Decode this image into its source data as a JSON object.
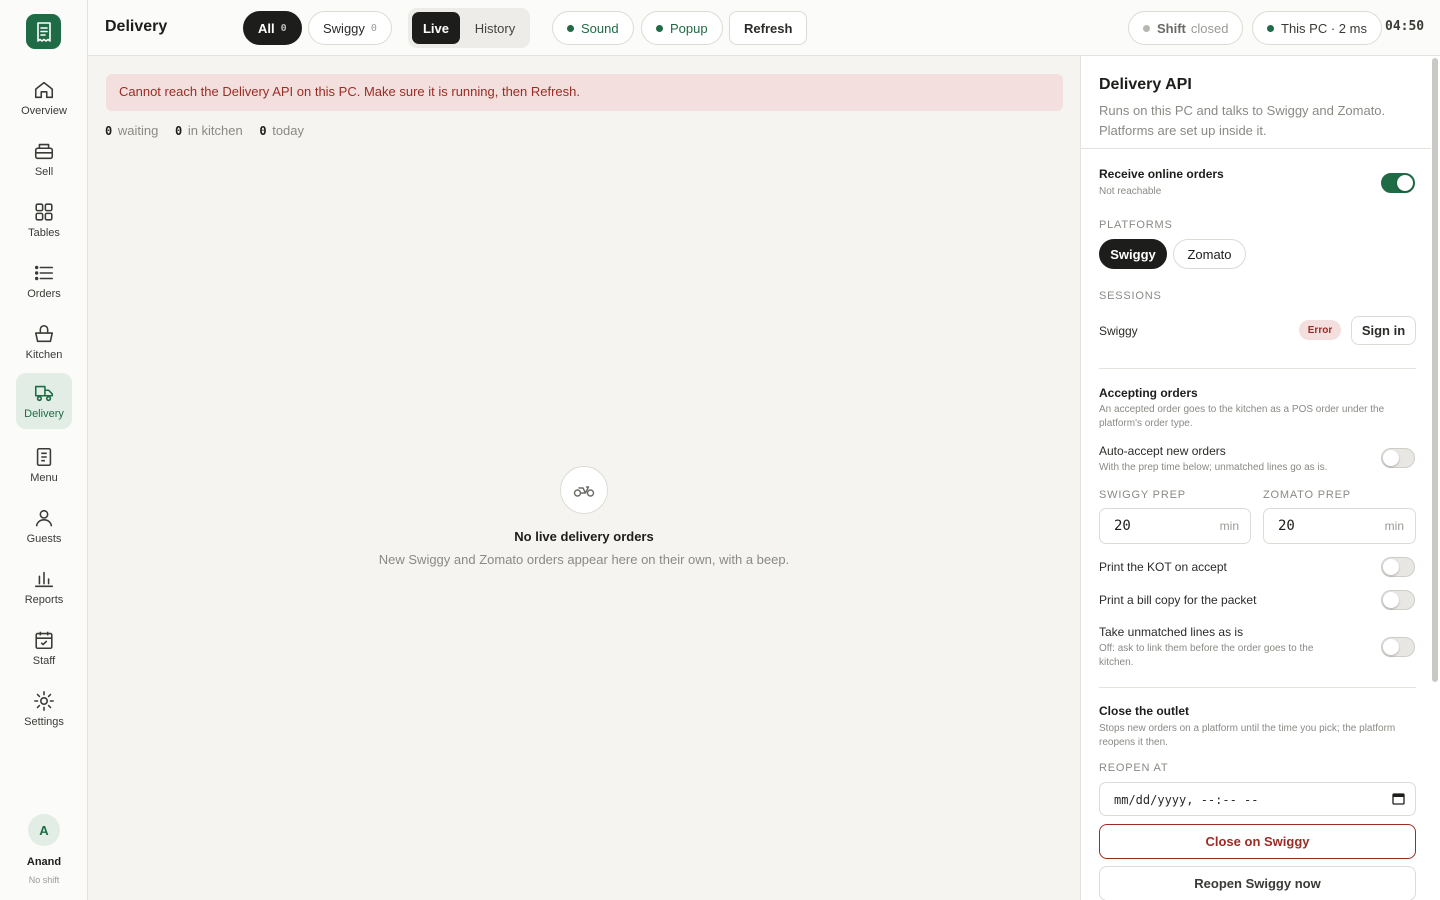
{
  "sidebar": {
    "logo": "receipt-icon",
    "items": [
      {
        "label": "Overview",
        "icon": "home-icon"
      },
      {
        "label": "Sell",
        "icon": "register-icon"
      },
      {
        "label": "Tables",
        "icon": "grid-icon"
      },
      {
        "label": "Orders",
        "icon": "list-icon"
      },
      {
        "label": "Kitchen",
        "icon": "basket-icon"
      },
      {
        "label": "Delivery",
        "icon": "delivery-truck-icon",
        "active": true
      },
      {
        "label": "Menu",
        "icon": "menu-doc-icon"
      },
      {
        "label": "Guests",
        "icon": "person-icon"
      },
      {
        "label": "Reports",
        "icon": "bar-chart-icon"
      },
      {
        "label": "Staff",
        "icon": "calendar-check-icon"
      },
      {
        "label": "Settings",
        "icon": "gear-icon"
      }
    ],
    "user": {
      "initial": "A",
      "name": "Anand",
      "shift": "No shift"
    }
  },
  "topbar": {
    "title": "Delivery",
    "filters": [
      {
        "label": "All",
        "count": "0",
        "active": true
      },
      {
        "label": "Swiggy",
        "count": "0",
        "active": false
      }
    ],
    "view_toggle": {
      "live": "Live",
      "history": "History",
      "selected": "Live"
    },
    "sound": "Sound",
    "popup": "Popup",
    "refresh": "Refresh",
    "shift_label": "Shift",
    "shift_status": "closed",
    "connection": "This PC · 2 ms",
    "clock": "04:50"
  },
  "main": {
    "error_banner": "Cannot reach the Delivery API on this PC. Make sure it is running, then Refresh.",
    "stats": [
      {
        "value": "0",
        "label": "waiting"
      },
      {
        "value": "0",
        "label": "in kitchen"
      },
      {
        "value": "0",
        "label": "today"
      }
    ],
    "empty": {
      "icon": "scooter-icon",
      "title": "No live delivery orders",
      "subtitle": "New Swiggy and Zomato orders appear here on their own, with a beep."
    }
  },
  "panel": {
    "title": "Delivery API",
    "description": "Runs on this PC and talks to Swiggy and Zomato. Platforms are set up inside it.",
    "receive": {
      "label": "Receive online orders",
      "status": "Not reachable",
      "enabled": true
    },
    "platforms_caption": "PLATFORMS",
    "platforms": [
      "Swiggy",
      "Zomato"
    ],
    "selected_platform": "Swiggy",
    "sessions_caption": "SESSIONS",
    "session": {
      "platform": "Swiggy",
      "badge": "Error",
      "action": "Sign in"
    },
    "accepting": {
      "title": "Accepting orders",
      "desc": "An accepted order goes to the kitchen as a POS order under the platform's order type.",
      "auto_accept": {
        "label": "Auto-accept new orders",
        "desc": "With the prep time below; unmatched lines go as is.",
        "enabled": false
      },
      "swiggy_prep": {
        "caption": "SWIGGY PREP",
        "value": "20",
        "unit": "min"
      },
      "zomato_prep": {
        "caption": "ZOMATO PREP",
        "value": "20",
        "unit": "min"
      },
      "print_kot": {
        "label": "Print the KOT on accept",
        "enabled": false
      },
      "print_bill": {
        "label": "Print a bill copy for the packet",
        "enabled": false
      },
      "unmatched": {
        "label": "Take unmatched lines as is",
        "desc": "Off: ask to link them before the order goes to the kitchen.",
        "enabled": false
      }
    },
    "close_outlet": {
      "title": "Close the outlet",
      "desc": "Stops new orders on a platform until the time you pick; the platform reopens it then.",
      "reopen_caption": "REOPEN AT",
      "reopen_placeholder": "mm/dd/yyyy, --:-- --",
      "close_button": "Close on Swiggy",
      "reopen_button": "Reopen Swiggy now"
    }
  },
  "colors": {
    "accent": "#1f6b45",
    "danger": "#9b2c25",
    "danger_bg": "#f3dfdd"
  }
}
